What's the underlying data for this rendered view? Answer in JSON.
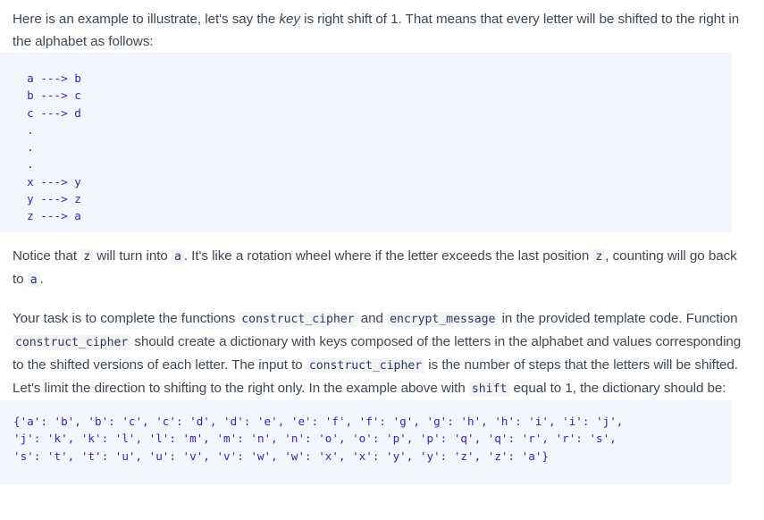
{
  "document": {
    "paragraph_1": {
      "part_1": "Here is an example to illustrate, let's say the ",
      "emphasis": "key",
      "part_2": " is right shift of 1. That means that every letter will be shifted to the right in the alphabet as follows:"
    },
    "code_block_mapping": "  a ---> b\n  b ---> c\n  c ---> d\n  .\n  .\n  .\n  x ---> y\n  y ---> z\n  z ---> a",
    "paragraph_2": {
      "part_1": "Notice that ",
      "code_1": "z",
      "part_2": " will turn into ",
      "code_2": "a",
      "part_3": ". It's like a rotation wheel where if the letter exceeds the last position ",
      "code_3": "z",
      "part_4": ", counting will go back to ",
      "code_4": "a",
      "part_5": "."
    },
    "paragraph_3": {
      "part_1": "Your task is to complete the functions ",
      "code_1": "construct_cipher",
      "part_2": " and ",
      "code_2": "encrypt_message",
      "part_3": " in the provided template code. Function ",
      "code_3": "construct_cipher",
      "part_4": " should create a dictionary with keys composed of the letters in the alphabet and values corresponding to the shifted versions of each letter. The input to ",
      "code_4": "construct_cipher",
      "part_5": " is the number of steps that the letters will be shifted. Let's limit the direction to shifting to the right only. In the example above with ",
      "code_5": "shift",
      "part_6": " equal to 1, the dictionary should be:"
    },
    "code_block_dictionary": "{'a': 'b', 'b': 'c', 'c': 'd', 'd': 'e', 'e': 'f', 'f': 'g', 'g': 'h', 'h': 'i', 'i': 'j',\n'j': 'k', 'k': 'l', 'l': 'm', 'm': 'n', 'n': 'o', 'o': 'p', 'p': 'q', 'q': 'r', 'r': 's',\n's': 't', 't': 'u', 'u': 'v', 'v': 'w', 'w': 'x', 'x': 'y', 'y': 'z', 'z': 'a'}"
  },
  "colors": {
    "page_background": "#ffffff",
    "body_text": "#3d4852",
    "code_block_background": "#f3f6fd",
    "code_block_text": "#2a2ab5",
    "inline_code_background": "#f4f4f4",
    "inline_code_text": "#2b3a67"
  }
}
